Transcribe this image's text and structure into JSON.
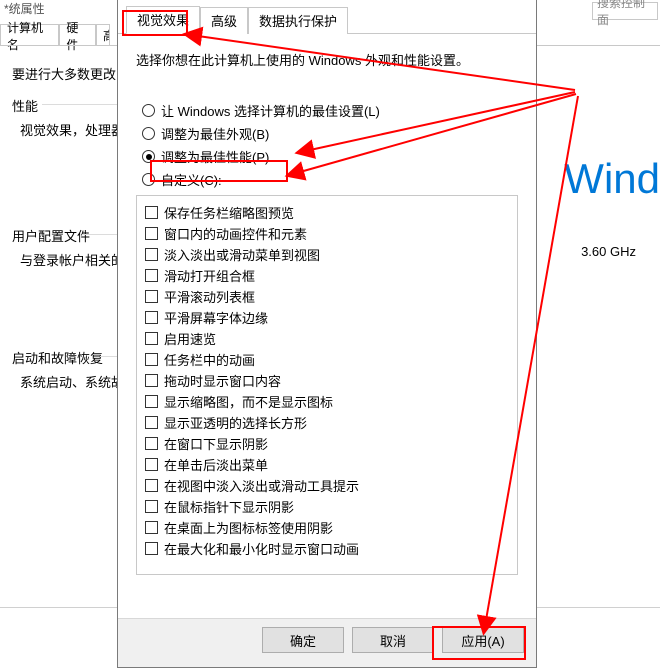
{
  "bg": {
    "title": "*统属性",
    "search_placeholder": "搜索控制面",
    "tab_computer_name": "计算机名",
    "tab_hardware": "硬件",
    "tab_advanced_cut": "高",
    "line_require_admin": "要进行大多数更改",
    "group_performance": "性能",
    "perf_desc": "视觉效果，处理器",
    "group_userprofile": "用户配置文件",
    "userprofile_desc": "与登录帐户相关的",
    "group_startup": "启动和故障恢复",
    "startup_desc": "系统启动、系统故",
    "brand_text": "Wind",
    "cpu_freq": "3.60 GHz"
  },
  "dlg": {
    "tab_visual": "视觉效果",
    "tab_advanced": "高级",
    "tab_dep": "数据执行保护",
    "desc": "选择你想在此计算机上使用的 Windows 外观和性能设置。",
    "radio_let_windows": "让 Windows 选择计算机的最佳设置(L)",
    "radio_best_appearance": "调整为最佳外观(B)",
    "radio_best_performance": "调整为最佳性能(P)",
    "radio_custom": "自定义(C):",
    "options": [
      "保存任务栏缩略图预览",
      "窗口内的动画控件和元素",
      "淡入淡出或滑动菜单到视图",
      "滑动打开组合框",
      "平滑滚动列表框",
      "平滑屏幕字体边缘",
      "启用速览",
      "任务栏中的动画",
      "拖动时显示窗口内容",
      "显示缩略图，而不是显示图标",
      "显示亚透明的选择长方形",
      "在窗口下显示阴影",
      "在单击后淡出菜单",
      "在视图中淡入淡出或滑动工具提示",
      "在鼠标指针下显示阴影",
      "在桌面上为图标标签使用阴影",
      "在最大化和最小化时显示窗口动画"
    ],
    "btn_ok": "确定",
    "btn_cancel": "取消",
    "btn_apply": "应用(A)"
  }
}
